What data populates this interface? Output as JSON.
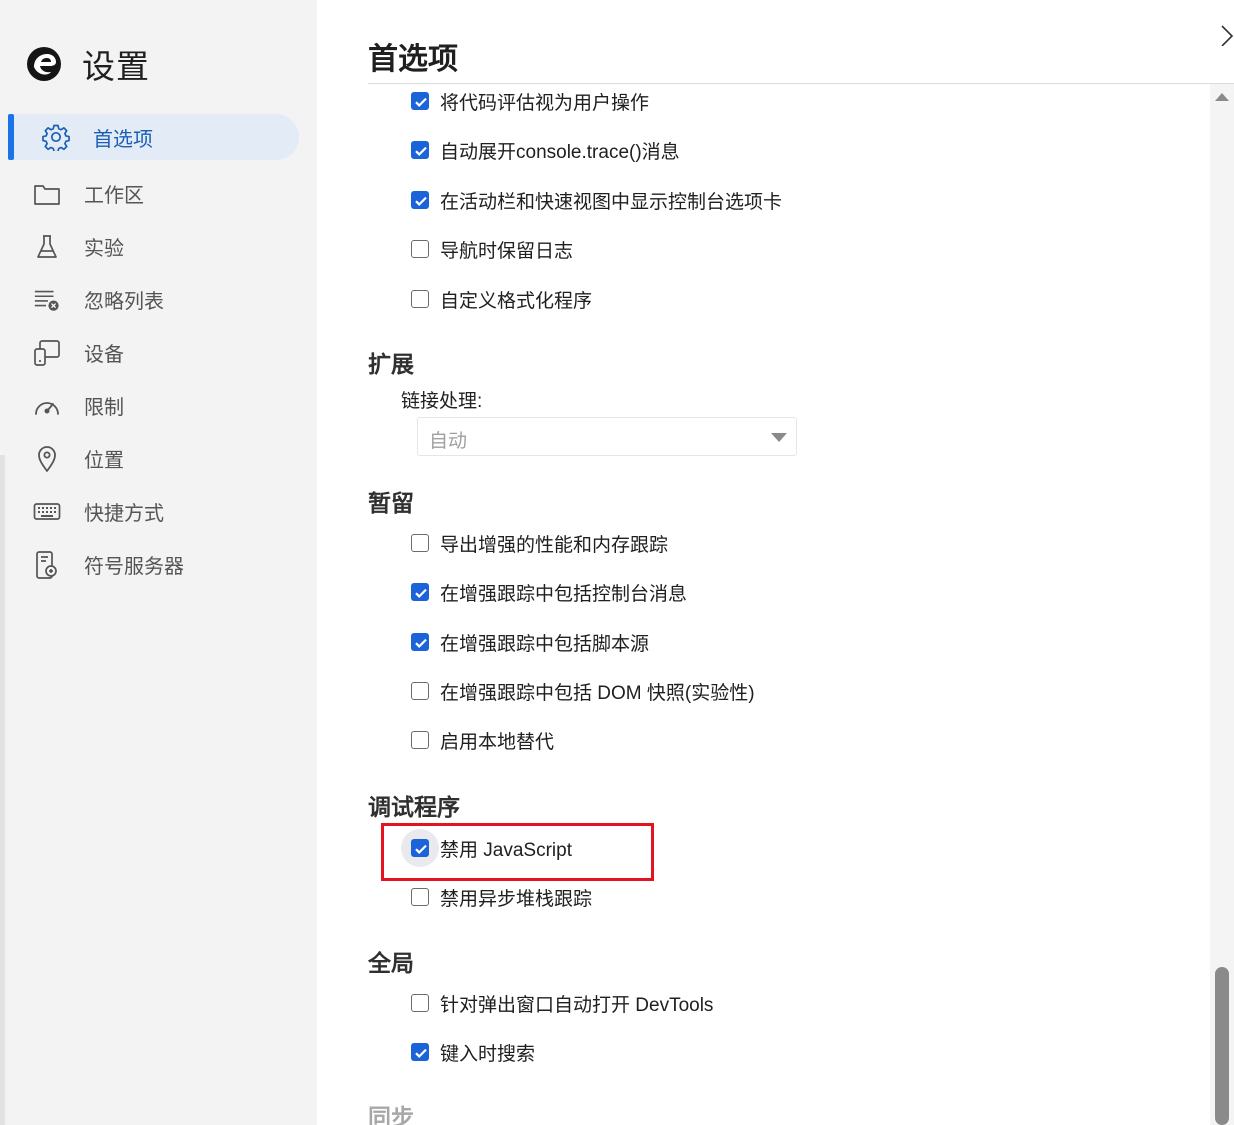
{
  "sidebar": {
    "title": "设置",
    "items": [
      {
        "label": "首选项",
        "icon": "gear-icon",
        "active": true
      },
      {
        "label": "工作区",
        "icon": "folder-icon"
      },
      {
        "label": "实验",
        "icon": "flask-icon"
      },
      {
        "label": "忽略列表",
        "icon": "ignore-list-icon"
      },
      {
        "label": "设备",
        "icon": "devices-icon"
      },
      {
        "label": "限制",
        "icon": "gauge-icon"
      },
      {
        "label": "位置",
        "icon": "location-pin-icon"
      },
      {
        "label": "快捷方式",
        "icon": "keyboard-icon"
      },
      {
        "label": "符号服务器",
        "icon": "symbol-server-icon"
      }
    ]
  },
  "main": {
    "title": "首选项",
    "console_options": [
      {
        "label": "将代码评估视为用户操作",
        "checked": true
      },
      {
        "label": "自动展开console.trace()消息",
        "checked": true
      },
      {
        "label": "在活动栏和快速视图中显示控制台选项卡",
        "checked": true
      },
      {
        "label": "导航时保留日志",
        "checked": false
      },
      {
        "label": "自定义格式化程序",
        "checked": false
      }
    ],
    "extensions": {
      "heading": "扩展",
      "link_label": "链接处理:",
      "link_value": "自动"
    },
    "persistence": {
      "heading": "暂留",
      "options": [
        {
          "label": "导出增强的性能和内存跟踪",
          "checked": false
        },
        {
          "label": "在增强跟踪中包括控制台消息",
          "checked": true
        },
        {
          "label": "在增强跟踪中包括脚本源",
          "checked": true
        },
        {
          "label": "在增强跟踪中包括 DOM 快照(实验性)",
          "checked": false
        },
        {
          "label": "启用本地替代",
          "checked": false
        }
      ]
    },
    "debugger": {
      "heading": "调试程序",
      "options": [
        {
          "label": "禁用 JavaScript",
          "checked": true
        },
        {
          "label": "禁用异步堆栈跟踪",
          "checked": false
        }
      ]
    },
    "global": {
      "heading": "全局",
      "options": [
        {
          "label": "针对弹出窗口自动打开 DevTools",
          "checked": false
        },
        {
          "label": "键入时搜索",
          "checked": true
        }
      ]
    },
    "sync": {
      "heading": "同步"
    }
  },
  "colors": {
    "accent": "#1a63d8",
    "highlight_box": "#e3141f",
    "sidebar_bg": "#f3f3f3",
    "active_nav_bg": "#e3ebf7"
  }
}
